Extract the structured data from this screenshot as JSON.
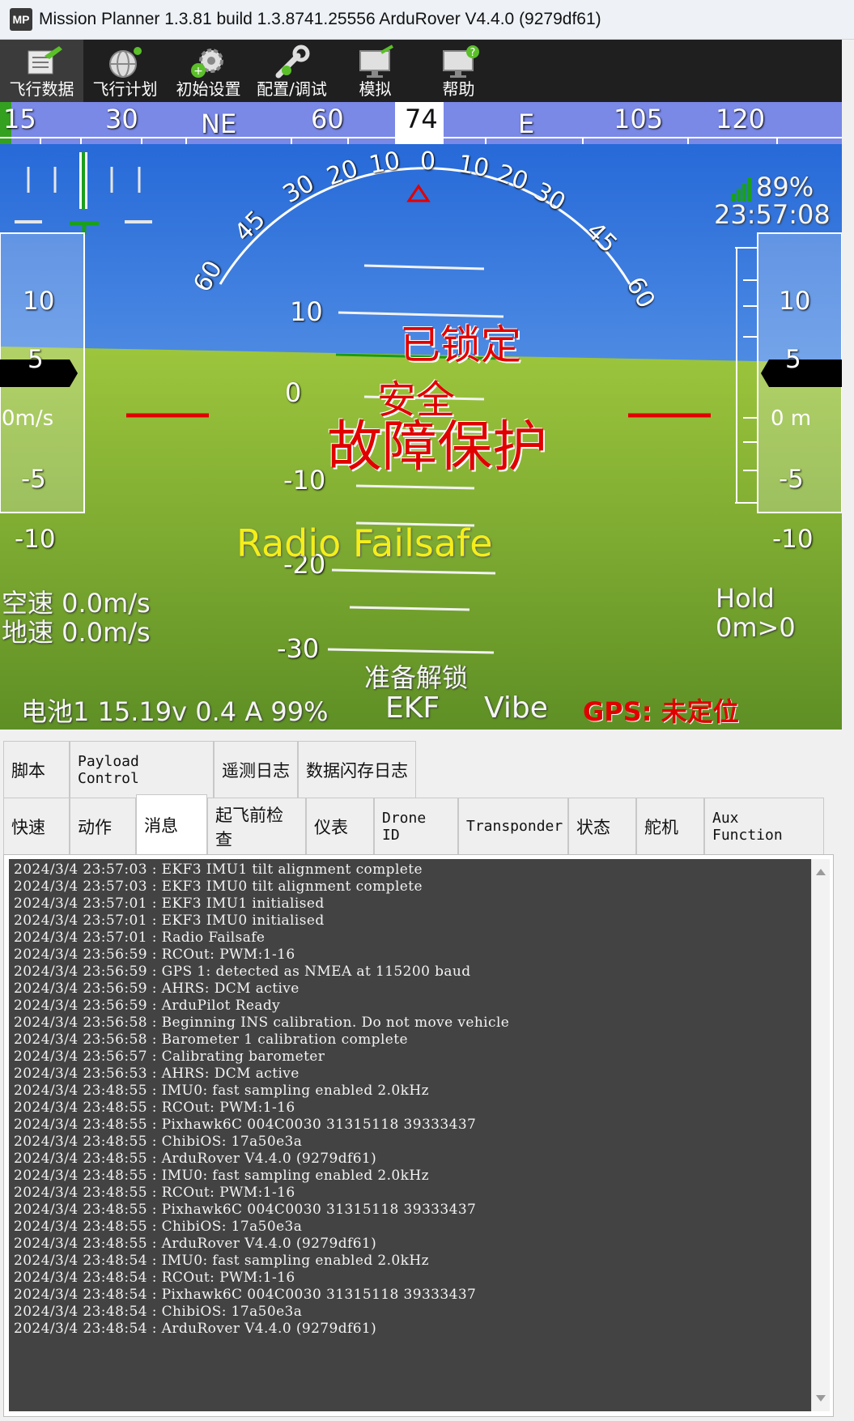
{
  "window": {
    "icon_text": "MP",
    "title": "Mission Planner 1.3.81 build 1.3.8741.25556 ArduRover V4.4.0 (9279df61)"
  },
  "toolbar": {
    "items": [
      {
        "label": "飞行数据",
        "icon": "flight-data-icon"
      },
      {
        "label": "飞行计划",
        "icon": "flight-plan-icon"
      },
      {
        "label": "初始设置",
        "icon": "initial-setup-icon"
      },
      {
        "label": "配置/调试",
        "icon": "config-tuning-icon"
      },
      {
        "label": "模拟",
        "icon": "simulation-icon"
      },
      {
        "label": "帮助",
        "icon": "help-icon"
      }
    ]
  },
  "hud": {
    "heading": {
      "labels": [
        "15",
        "30",
        "NE",
        "60",
        "74",
        "E",
        "105",
        "120"
      ],
      "current": "74"
    },
    "roll_scale": {
      "left": [
        "60",
        "45",
        "30",
        "20",
        "10"
      ],
      "center": "0",
      "right": [
        "10",
        "20",
        "30",
        "45",
        "60"
      ]
    },
    "pitch_labels": [
      "10",
      "0",
      "-10",
      "-20",
      "-30"
    ],
    "left_tape": {
      "labels": [
        "10",
        "5",
        "-5",
        "-10"
      ],
      "current": "0m/s"
    },
    "right_tape": {
      "labels": [
        "10",
        "5",
        "-5",
        "-10"
      ],
      "current": "0 m"
    },
    "signal": {
      "percent": "89%",
      "time": "23:57:08",
      "bars": 4
    },
    "status_lines": {
      "locked": "已锁定",
      "safety": "安全",
      "failsafe": "故障保护",
      "radio_failsafe": "Radio Failsafe",
      "airspeed": "空速 0.0m/s",
      "groundspeed": "地速 0.0m/s",
      "mode": "Hold",
      "wp": "0m>0",
      "ready": "准备解锁",
      "battery": "电池1 15.19v 0.4 A 99%",
      "ekf": "EKF",
      "vibe": "Vibe",
      "gps": "GPS: 未定位"
    },
    "colors": {
      "sky": "#4f97e6",
      "ground": "#8fb83a",
      "heading_bar": "#7a88e6",
      "alert_red": "#e00000",
      "radio_failsafe": "#f5ee19"
    }
  },
  "tabs": {
    "row1": [
      {
        "label": "脚本"
      },
      {
        "label": "Payload Control"
      },
      {
        "label": "遥测日志"
      },
      {
        "label": "数据闪存日志"
      }
    ],
    "row2": [
      {
        "label": "快速"
      },
      {
        "label": "动作"
      },
      {
        "label": "消息"
      },
      {
        "label": "起飞前检查"
      },
      {
        "label": "仪表"
      },
      {
        "label": "Drone ID"
      },
      {
        "label": "Transponder"
      },
      {
        "label": "状态"
      },
      {
        "label": "舵机"
      },
      {
        "label": "Aux Function"
      }
    ],
    "selected": "消息"
  },
  "messages": [
    "2024/3/4 23:57:03 : EKF3 IMU1 tilt alignment complete",
    "2024/3/4 23:57:03 : EKF3 IMU0 tilt alignment complete",
    "2024/3/4 23:57:01 : EKF3 IMU1 initialised",
    "2024/3/4 23:57:01 : EKF3 IMU0 initialised",
    "2024/3/4 23:57:01 : Radio Failsafe",
    "2024/3/4 23:56:59 : RCOut: PWM:1-16",
    "2024/3/4 23:56:59 : GPS 1: detected as NMEA at 115200 baud",
    "2024/3/4 23:56:59 : AHRS: DCM active",
    "2024/3/4 23:56:59 : ArduPilot Ready",
    "2024/3/4 23:56:58 : Beginning INS calibration. Do not move vehicle",
    "2024/3/4 23:56:58 : Barometer 1 calibration complete",
    "2024/3/4 23:56:57 : Calibrating barometer",
    "2024/3/4 23:56:53 : AHRS: DCM active",
    "2024/3/4 23:48:55 : IMU0: fast sampling enabled 2.0kHz",
    "2024/3/4 23:48:55 : RCOut: PWM:1-16",
    "2024/3/4 23:48:55 : Pixhawk6C 004C0030 31315118 39333437",
    "2024/3/4 23:48:55 : ChibiOS: 17a50e3a",
    "2024/3/4 23:48:55 : ArduRover V4.4.0 (9279df61)",
    "2024/3/4 23:48:55 : IMU0: fast sampling enabled 2.0kHz",
    "2024/3/4 23:48:55 : RCOut: PWM:1-16",
    "2024/3/4 23:48:55 : Pixhawk6C 004C0030 31315118 39333437",
    "2024/3/4 23:48:55 : ChibiOS: 17a50e3a",
    "2024/3/4 23:48:55 : ArduRover V4.4.0 (9279df61)",
    "2024/3/4 23:48:54 : IMU0: fast sampling enabled 2.0kHz",
    "2024/3/4 23:48:54 : RCOut: PWM:1-16",
    "2024/3/4 23:48:54 : Pixhawk6C 004C0030 31315118 39333437",
    "2024/3/4 23:48:54 : ChibiOS: 17a50e3a",
    "2024/3/4 23:48:54 : ArduRover V4.4.0 (9279df61)"
  ]
}
